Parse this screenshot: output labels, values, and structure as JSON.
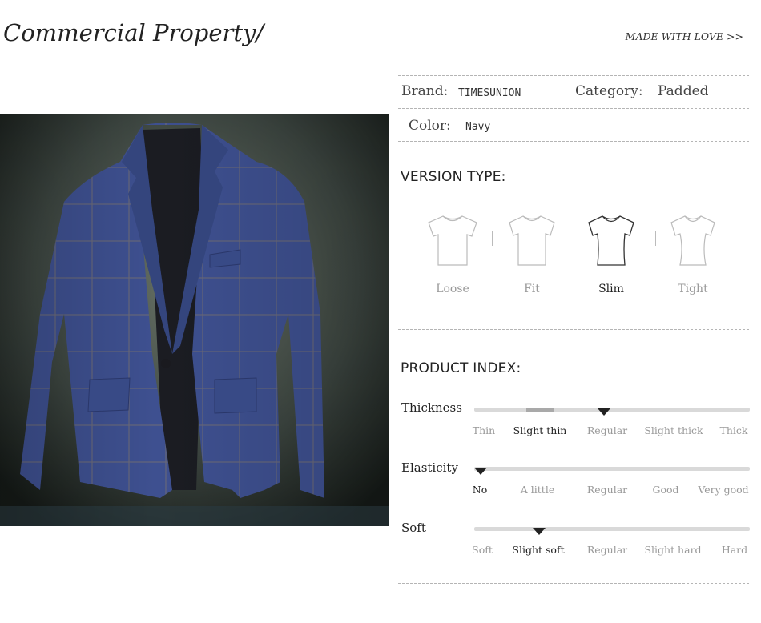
{
  "header": {
    "title": "Commercial Property/",
    "tagline": "MADE WITH LOVE >>"
  },
  "product_image": {
    "subject": "navy plaid single-button blazer"
  },
  "attributes": {
    "brand_label": "Brand:",
    "brand_value": "TIMESUNION",
    "category_label": "Category:",
    "category_value": "Padded",
    "color_label": "Color:",
    "color_value": "Navy"
  },
  "version_type": {
    "title": "VERSION TYPE:",
    "options": [
      {
        "label": "Loose",
        "icon": "tshirt-loose-icon",
        "selected": false
      },
      {
        "label": "Fit",
        "icon": "tshirt-fit-icon",
        "selected": false
      },
      {
        "label": "Slim",
        "icon": "tshirt-slim-icon",
        "selected": true
      },
      {
        "label": "Tight",
        "icon": "tshirt-tight-icon",
        "selected": false
      }
    ]
  },
  "product_index": {
    "title": "PRODUCT INDEX:",
    "scales": [
      {
        "name": "Thickness",
        "ticks": [
          "Thin",
          "Slight thin",
          "Regular",
          "Slight thick",
          "Thick"
        ],
        "active_index": 1,
        "marker_position": 0.47
      },
      {
        "name": "Elasticity",
        "ticks": [
          "No",
          "A little",
          "Regular",
          "Good",
          "Very good"
        ],
        "active_index": 0,
        "marker_position": 0.02
      },
      {
        "name": "Soft",
        "ticks": [
          "Soft",
          "Slight soft",
          "Regular",
          "Slight hard",
          "Hard"
        ],
        "active_index": 1,
        "marker_position": 0.23
      }
    ]
  },
  "colors": {
    "accent": "#222222",
    "muted": "#999999",
    "track": "#d9d9d9",
    "blazer": "#3d4f88"
  }
}
